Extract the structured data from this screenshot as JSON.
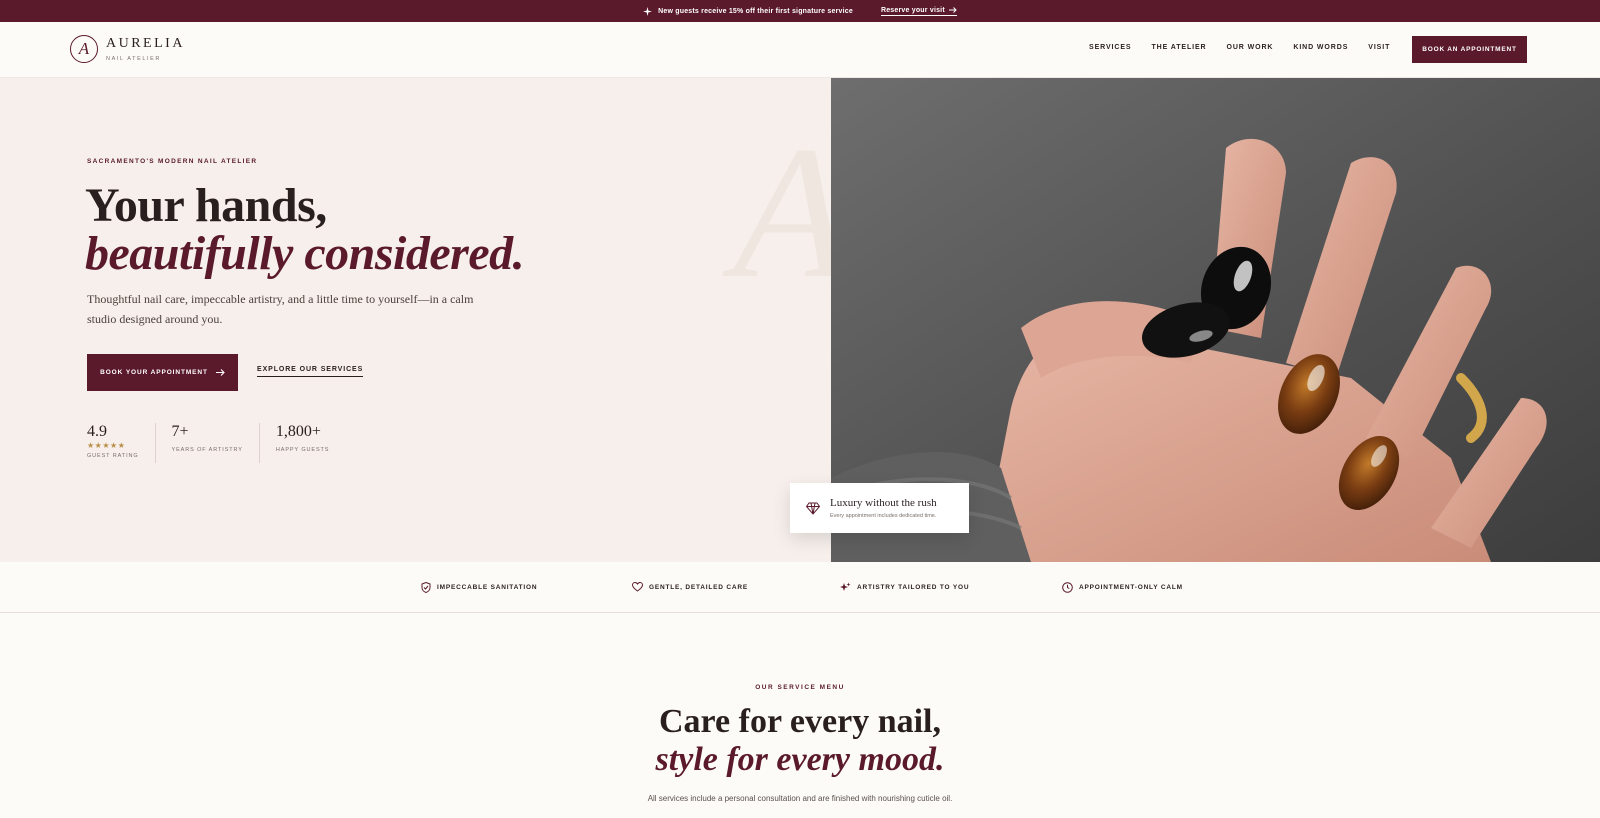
{
  "announcement": {
    "message": "New guests receive 15% off their first signature service",
    "cta": "Reserve your visit"
  },
  "header": {
    "logo_mark": "A",
    "brand": "AURELIA",
    "tagline": "NAIL ATELIER",
    "nav": [
      "SERVICES",
      "THE ATELIER",
      "OUR WORK",
      "KIND WORDS",
      "VISIT"
    ],
    "book_button": "BOOK AN APPOINTMENT"
  },
  "hero": {
    "watermark": "A",
    "eyebrow": "SACRAMENTO'S MODERN NAIL ATELIER",
    "headline_line1": "Your hands,",
    "headline_line2": "beautifully considered.",
    "lede": "Thoughtful nail care, impeccable artistry, and a little time to yourself—in a calm studio designed around you.",
    "primary_cta": "BOOK YOUR APPOINTMENT",
    "secondary_cta": "EXPLORE OUR SERVICES",
    "stats": [
      {
        "value": "4.9",
        "stars": "★★★★★",
        "label": "GUEST RATING"
      },
      {
        "value": "7+",
        "stars": "",
        "label": "YEARS OF ARTISTRY"
      },
      {
        "value": "1,800+",
        "stars": "",
        "label": "HAPPY GUESTS"
      }
    ],
    "card_title": "Luxury without the rush",
    "card_subtitle": "Every appointment includes dedicated time."
  },
  "features": [
    {
      "icon": "shield-check-icon",
      "label": "IMPECCABLE SANITATION"
    },
    {
      "icon": "heart-icon",
      "label": "GENTLE, DETAILED CARE"
    },
    {
      "icon": "sparkle-icon",
      "label": "ARTISTRY TAILORED TO YOU"
    },
    {
      "icon": "clock-icon",
      "label": "APPOINTMENT-ONLY CALM"
    }
  ],
  "services": {
    "eyebrow": "OUR SERVICE MENU",
    "heading_line1": "Care for every nail,",
    "heading_line2": "style for every mood.",
    "description": "All services include a personal consultation and are finished with nourishing cuticle oil."
  },
  "colors": {
    "brand": "#5a1a2b",
    "hero_bg": "#f6efeb",
    "page_bg": "#fdfbf8",
    "gold": "#b88f4a"
  }
}
